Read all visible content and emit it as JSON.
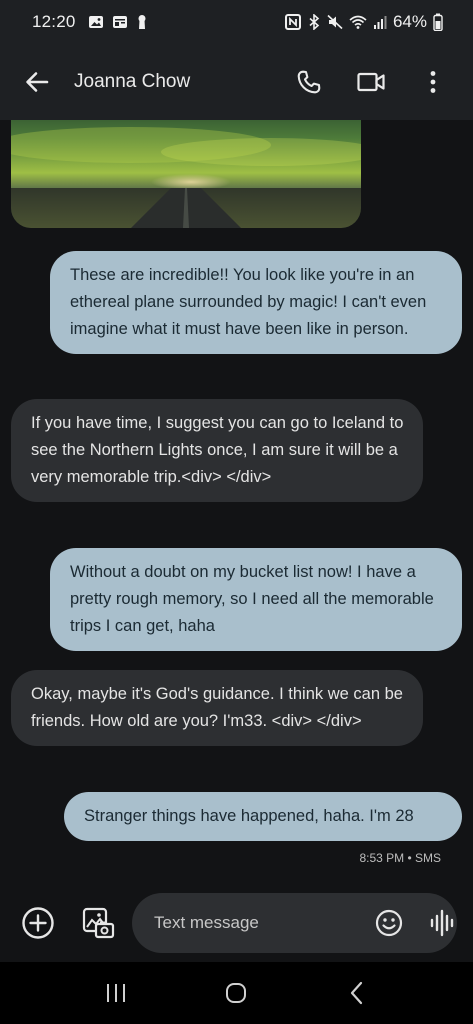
{
  "status_bar": {
    "time": "12:20",
    "battery": "64%",
    "left_icons": [
      "image-icon",
      "calendar-icon",
      "keyhole-icon"
    ],
    "right_icons": [
      "nfc-icon",
      "bluetooth-icon",
      "mute-icon",
      "wifi-icon",
      "signal-icon",
      "battery-icon"
    ]
  },
  "app_bar": {
    "contact_name": "Joanna Chow",
    "actions": [
      "phone-icon",
      "video-call-icon",
      "more-vert-icon"
    ]
  },
  "messages": [
    {
      "direction": "outgoing",
      "text": "These are incredible!! You look like you're in an ethereal plane surrounded by magic! I can't even imagine what it must have been like in person."
    },
    {
      "direction": "incoming",
      "text": "If you have time, I suggest you can go to Iceland to see the Northern Lights once, I am sure it will be a very memorable trip.<div> </div>"
    },
    {
      "direction": "outgoing",
      "text": "Without a doubt on my bucket list now! I have a pretty rough memory, so I need all the memorable trips I can get, haha"
    },
    {
      "direction": "incoming",
      "text": "Okay, maybe it's God's guidance. I think we can be friends. How old are you? I'm33. <div> </div>"
    },
    {
      "direction": "outgoing",
      "text": "Stranger things have happened, haha. I'm 28"
    }
  ],
  "last_message_meta": "8:53 PM • SMS",
  "composer": {
    "placeholder": "Text message",
    "icons": [
      "add-icon",
      "gallery-icon",
      "emoji-icon",
      "voice-icon"
    ]
  },
  "colors": {
    "outgoing_bubble": "#a9bfcc",
    "incoming_bubble": "#2d2f32",
    "background": "#121315",
    "bar": "#1e2023"
  }
}
